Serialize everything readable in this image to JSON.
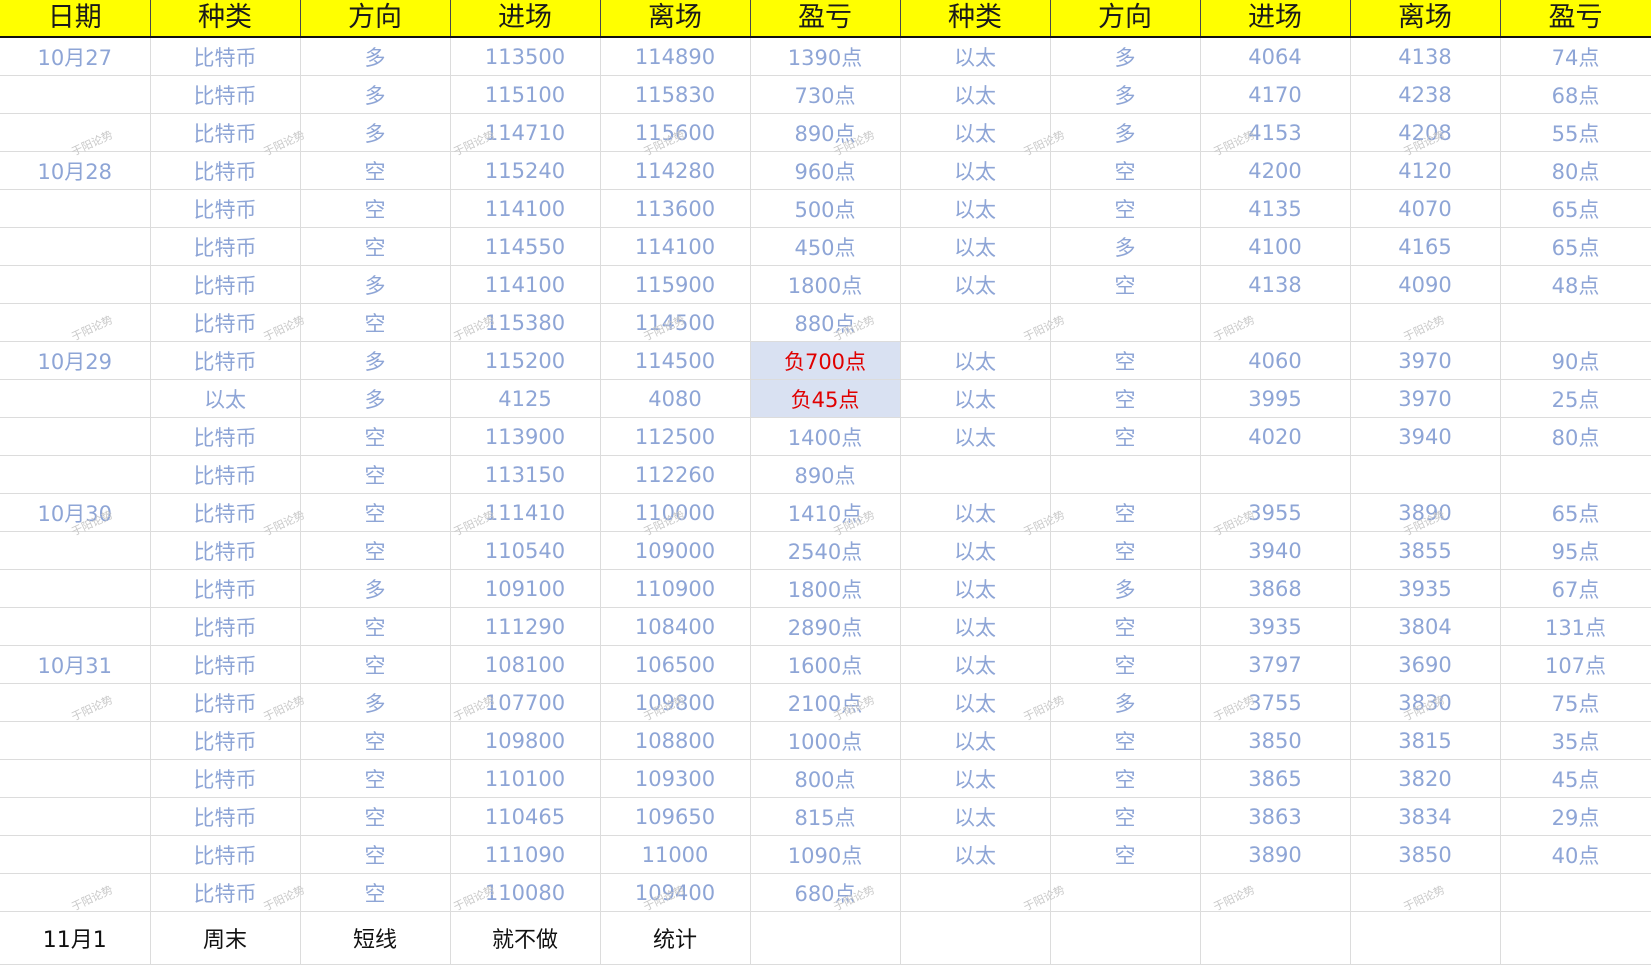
{
  "headers": [
    "日期",
    "种类",
    "方向",
    "进场",
    "离场",
    "盈亏",
    "种类",
    "方向",
    "进场",
    "离场",
    "盈亏"
  ],
  "rows": [
    [
      "10月27",
      "比特币",
      "多",
      "113500",
      "114890",
      "1390点",
      "以太",
      "多",
      "4064",
      "4138",
      "74点"
    ],
    [
      "",
      "比特币",
      "多",
      "115100",
      "115830",
      "730点",
      "以太",
      "多",
      "4170",
      "4238",
      "68点"
    ],
    [
      "",
      "比特币",
      "多",
      "114710",
      "115600",
      "890点",
      "以太",
      "多",
      "4153",
      "4208",
      "55点"
    ],
    [
      "10月28",
      "比特币",
      "空",
      "115240",
      "114280",
      "960点",
      "以太",
      "空",
      "4200",
      "4120",
      "80点"
    ],
    [
      "",
      "比特币",
      "空",
      "114100",
      "113600",
      "500点",
      "以太",
      "空",
      "4135",
      "4070",
      "65点"
    ],
    [
      "",
      "比特币",
      "空",
      "114550",
      "114100",
      "450点",
      "以太",
      "多",
      "4100",
      "4165",
      "65点"
    ],
    [
      "",
      "比特币",
      "多",
      "114100",
      "115900",
      "1800点",
      "以太",
      "空",
      "4138",
      "4090",
      "48点"
    ],
    [
      "",
      "比特币",
      "空",
      "115380",
      "114500",
      "880点",
      "",
      "",
      "",
      "",
      ""
    ],
    [
      "10月29",
      "比特币",
      "多",
      "115200",
      "114500",
      "负700点",
      "以太",
      "空",
      "4060",
      "3970",
      "90点"
    ],
    [
      "",
      "以太",
      "多",
      "4125",
      "4080",
      "负45点",
      "以太",
      "空",
      "3995",
      "3970",
      "25点"
    ],
    [
      "",
      "比特币",
      "空",
      "113900",
      "112500",
      "1400点",
      "以太",
      "空",
      "4020",
      "3940",
      "80点"
    ],
    [
      "",
      "比特币",
      "空",
      "113150",
      "112260",
      "890点",
      "",
      "",
      "",
      "",
      ""
    ],
    [
      "10月30",
      "比特币",
      "空",
      "111410",
      "110000",
      "1410点",
      "以太",
      "空",
      "3955",
      "3890",
      "65点"
    ],
    [
      "",
      "比特币",
      "空",
      "110540",
      "109000",
      "2540点",
      "以太",
      "空",
      "3940",
      "3855",
      "95点"
    ],
    [
      "",
      "比特币",
      "多",
      "109100",
      "110900",
      "1800点",
      "以太",
      "多",
      "3868",
      "3935",
      "67点"
    ],
    [
      "",
      "比特币",
      "空",
      "111290",
      "108400",
      "2890点",
      "以太",
      "空",
      "3935",
      "3804",
      "131点"
    ],
    [
      "10月31",
      "比特币",
      "空",
      "108100",
      "106500",
      "1600点",
      "以太",
      "空",
      "3797",
      "3690",
      "107点"
    ],
    [
      "",
      "比特币",
      "多",
      "107700",
      "109800",
      "2100点",
      "以太",
      "多",
      "3755",
      "3830",
      "75点"
    ],
    [
      "",
      "比特币",
      "空",
      "109800",
      "108800",
      "1000点",
      "以太",
      "空",
      "3850",
      "3815",
      "35点"
    ],
    [
      "",
      "比特币",
      "空",
      "110100",
      "109300",
      "800点",
      "以太",
      "空",
      "3865",
      "3820",
      "45点"
    ],
    [
      "",
      "比特币",
      "空",
      "110465",
      "109650",
      "815点",
      "以太",
      "空",
      "3863",
      "3834",
      "29点"
    ],
    [
      "",
      "比特币",
      "空",
      "111090",
      "11000",
      "1090点",
      "以太",
      "空",
      "3890",
      "3850",
      "40点"
    ],
    [
      "",
      "比特币",
      "空",
      "110080",
      "109400",
      "680点",
      "",
      "",
      "",
      "",
      ""
    ]
  ],
  "negative_cells": [
    [
      8,
      5
    ],
    [
      9,
      5
    ]
  ],
  "summary_row": [
    "11月1",
    "周末",
    "短线",
    "就不做",
    "统计",
    "",
    "",
    "",
    "",
    "",
    ""
  ],
  "watermark_text": "于阳论势",
  "colors": {
    "header_bg": "#ffff00",
    "cell_text": "#8ea5d6",
    "negative_text": "#e00000",
    "negative_bg": "#d9e1f2",
    "summary_text": "#111111"
  }
}
